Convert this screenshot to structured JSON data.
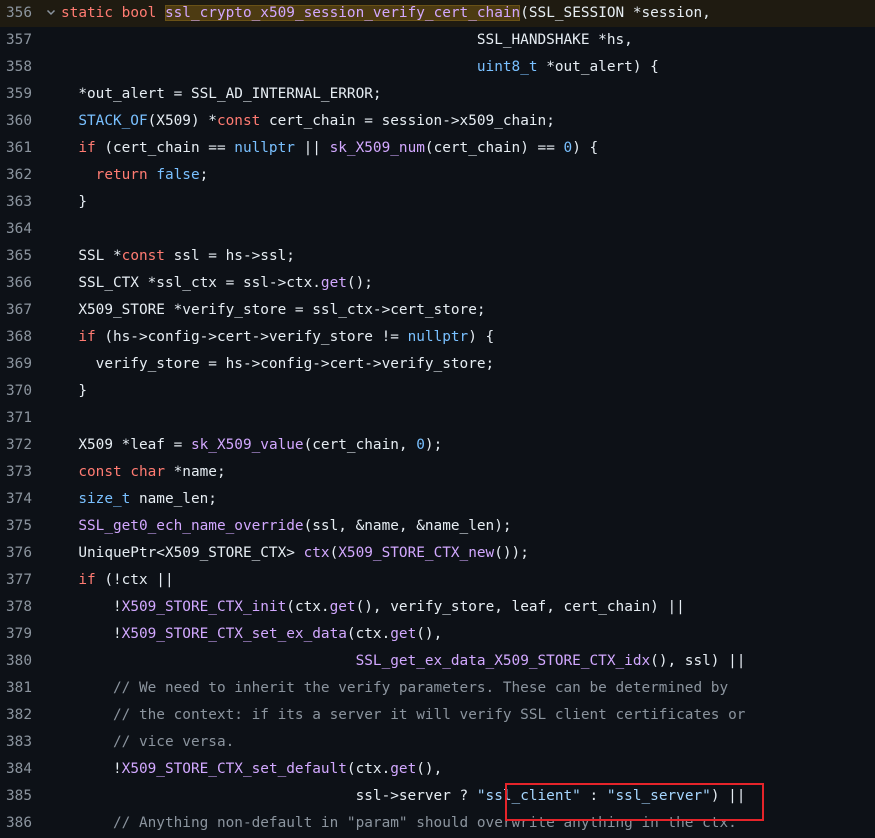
{
  "code_view": {
    "fold_icon": "chevron-down-icon",
    "highlight_box_color": "#e5242a",
    "lines": [
      {
        "num": "356",
        "tokens": [
          [
            "k",
            "static "
          ],
          [
            "k",
            "bool "
          ],
          [
            "h",
            "ssl_crypto_x509_session_verify_cert_chain"
          ],
          [
            "p",
            "(SSL_SESSION *session,"
          ]
        ]
      },
      {
        "num": "357",
        "tokens": [
          [
            "p",
            "                                                SSL_HANDSHAKE *hs,"
          ]
        ]
      },
      {
        "num": "358",
        "tokens": [
          [
            "p",
            "                                                "
          ],
          [
            "c",
            "uint8_t"
          ],
          [
            "p",
            " *out_alert) {"
          ]
        ]
      },
      {
        "num": "359",
        "tokens": [
          [
            "p",
            "  *out_alert = SSL_AD_INTERNAL_ERROR;"
          ]
        ]
      },
      {
        "num": "360",
        "tokens": [
          [
            "p",
            "  "
          ],
          [
            "c",
            "STACK_OF"
          ],
          [
            "p",
            "(X509) *"
          ],
          [
            "k",
            "const"
          ],
          [
            "p",
            " cert_chain = session->x509_chain;"
          ]
        ]
      },
      {
        "num": "361",
        "tokens": [
          [
            "p",
            "  "
          ],
          [
            "k",
            "if"
          ],
          [
            "p",
            " (cert_chain == "
          ],
          [
            "c",
            "nullptr"
          ],
          [
            "p",
            " || "
          ],
          [
            "f",
            "sk_X509_num"
          ],
          [
            "p",
            "(cert_chain) == "
          ],
          [
            "c",
            "0"
          ],
          [
            "p",
            ") {"
          ]
        ]
      },
      {
        "num": "362",
        "tokens": [
          [
            "p",
            "    "
          ],
          [
            "k",
            "return"
          ],
          [
            "p",
            " "
          ],
          [
            "c",
            "false"
          ],
          [
            "p",
            ";"
          ]
        ]
      },
      {
        "num": "363",
        "tokens": [
          [
            "p",
            "  }"
          ]
        ]
      },
      {
        "num": "364",
        "tokens": []
      },
      {
        "num": "365",
        "tokens": [
          [
            "p",
            "  SSL *"
          ],
          [
            "k",
            "const"
          ],
          [
            "p",
            " ssl = hs->ssl;"
          ]
        ]
      },
      {
        "num": "366",
        "tokens": [
          [
            "p",
            "  SSL_CTX *ssl_ctx = ssl->ctx."
          ],
          [
            "f",
            "get"
          ],
          [
            "p",
            "();"
          ]
        ]
      },
      {
        "num": "367",
        "tokens": [
          [
            "p",
            "  X509_STORE *verify_store = ssl_ctx->cert_store;"
          ]
        ]
      },
      {
        "num": "368",
        "tokens": [
          [
            "p",
            "  "
          ],
          [
            "k",
            "if"
          ],
          [
            "p",
            " (hs->config->cert->verify_store != "
          ],
          [
            "c",
            "nullptr"
          ],
          [
            "p",
            ") {"
          ]
        ]
      },
      {
        "num": "369",
        "tokens": [
          [
            "p",
            "    verify_store = hs->config->cert->verify_store;"
          ]
        ]
      },
      {
        "num": "370",
        "tokens": [
          [
            "p",
            "  }"
          ]
        ]
      },
      {
        "num": "371",
        "tokens": []
      },
      {
        "num": "372",
        "tokens": [
          [
            "p",
            "  X509 *leaf = "
          ],
          [
            "f",
            "sk_X509_value"
          ],
          [
            "p",
            "(cert_chain, "
          ],
          [
            "c",
            "0"
          ],
          [
            "p",
            ");"
          ]
        ]
      },
      {
        "num": "373",
        "tokens": [
          [
            "p",
            "  "
          ],
          [
            "k",
            "const"
          ],
          [
            "p",
            " "
          ],
          [
            "k",
            "char"
          ],
          [
            "p",
            " *name;"
          ]
        ]
      },
      {
        "num": "374",
        "tokens": [
          [
            "p",
            "  "
          ],
          [
            "c",
            "size_t"
          ],
          [
            "p",
            " name_len;"
          ]
        ]
      },
      {
        "num": "375",
        "tokens": [
          [
            "p",
            "  "
          ],
          [
            "f",
            "SSL_get0_ech_name_override"
          ],
          [
            "p",
            "(ssl, &name, &name_len);"
          ]
        ]
      },
      {
        "num": "376",
        "tokens": [
          [
            "p",
            "  UniquePtr<X509_STORE_CTX> "
          ],
          [
            "f",
            "ctx"
          ],
          [
            "p",
            "("
          ],
          [
            "f",
            "X509_STORE_CTX_new"
          ],
          [
            "p",
            "());"
          ]
        ]
      },
      {
        "num": "377",
        "tokens": [
          [
            "p",
            "  "
          ],
          [
            "k",
            "if"
          ],
          [
            "p",
            " (!ctx ||"
          ]
        ]
      },
      {
        "num": "378",
        "tokens": [
          [
            "p",
            "      !"
          ],
          [
            "f",
            "X509_STORE_CTX_init"
          ],
          [
            "p",
            "(ctx."
          ],
          [
            "f",
            "get"
          ],
          [
            "p",
            "(), verify_store, leaf, cert_chain) ||"
          ]
        ]
      },
      {
        "num": "379",
        "tokens": [
          [
            "p",
            "      !"
          ],
          [
            "f",
            "X509_STORE_CTX_set_ex_data"
          ],
          [
            "p",
            "(ctx."
          ],
          [
            "f",
            "get"
          ],
          [
            "p",
            "(),"
          ]
        ]
      },
      {
        "num": "380",
        "tokens": [
          [
            "p",
            "                                  "
          ],
          [
            "f",
            "SSL_get_ex_data_X509_STORE_CTX_idx"
          ],
          [
            "p",
            "(), ssl) ||"
          ]
        ]
      },
      {
        "num": "381",
        "tokens": [
          [
            "m",
            "      // We need to inherit the verify parameters. These can be determined by"
          ]
        ]
      },
      {
        "num": "382",
        "tokens": [
          [
            "m",
            "      // the context: if its a server it will verify SSL client certificates or"
          ]
        ]
      },
      {
        "num": "383",
        "tokens": [
          [
            "m",
            "      // vice versa."
          ]
        ]
      },
      {
        "num": "384",
        "tokens": [
          [
            "p",
            "      !"
          ],
          [
            "f",
            "X509_STORE_CTX_set_default"
          ],
          [
            "p",
            "(ctx."
          ],
          [
            "f",
            "get"
          ],
          [
            "p",
            "(),"
          ]
        ]
      },
      {
        "num": "385",
        "tokens": [
          [
            "p",
            "                                  ssl->server ? "
          ],
          [
            "s",
            "\"ssl_client\""
          ],
          [
            "p",
            " : "
          ],
          [
            "s",
            "\"ssl_server\""
          ],
          [
            "p",
            ") ||"
          ]
        ]
      },
      {
        "num": "386",
        "tokens": [
          [
            "m",
            "      // Anything non-default in \"param\" should overwrite anything in the ctx."
          ]
        ]
      }
    ]
  }
}
